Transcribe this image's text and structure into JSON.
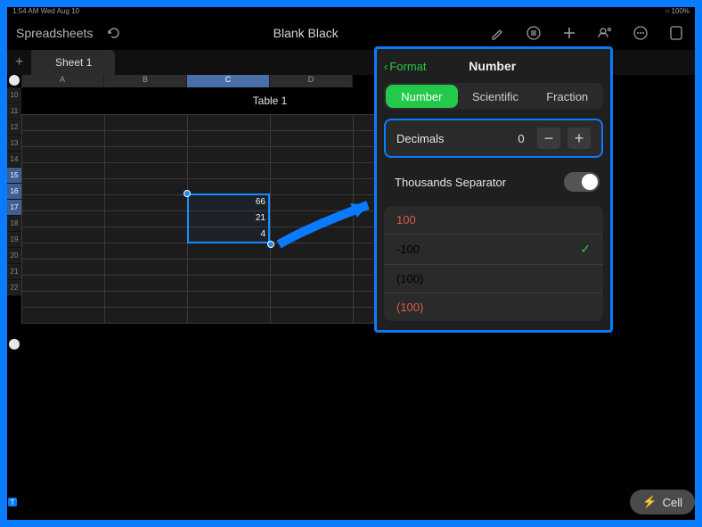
{
  "status": {
    "left": "1:54 AM  Wed Aug 10",
    "right": "○ 100%"
  },
  "toolbar": {
    "app_label": "Spreadsheets",
    "doc_title": "Blank Black"
  },
  "tabs": {
    "active": "Sheet 1"
  },
  "table": {
    "title": "Table 1"
  },
  "columns": [
    "A",
    "B",
    "C",
    "D"
  ],
  "rows": [
    "",
    "10",
    "11",
    "12",
    "13",
    "14",
    "15",
    "16",
    "17",
    "18",
    "19",
    "20",
    "21",
    "22"
  ],
  "cells": {
    "c15": "66",
    "c16": "21",
    "c17": "4"
  },
  "panel": {
    "back": "Format",
    "title": "Number",
    "tabs": {
      "number": "Number",
      "scientific": "Scientific",
      "fraction": "Fraction"
    },
    "decimals_label": "Decimals",
    "decimals_value": "0",
    "thousands_label": "Thousands Separator",
    "formats": [
      {
        "label": "100",
        "color": "#e05a4a",
        "selected": false
      },
      {
        "label": "-100",
        "color": "#e6e6e6",
        "selected": true
      },
      {
        "label": "(100)",
        "color": "#e6e6e6",
        "selected": false
      },
      {
        "label": "(100)",
        "color": "#e05a4a",
        "selected": false
      }
    ]
  },
  "bottom": {
    "hint": "",
    "pill": "Cell"
  }
}
